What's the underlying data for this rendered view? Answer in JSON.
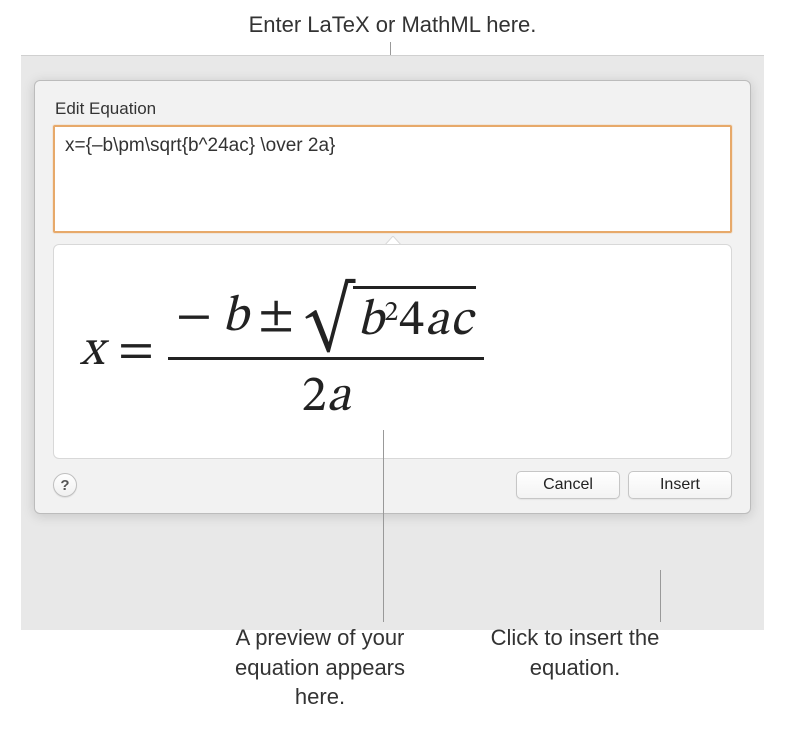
{
  "callouts": {
    "top": "Enter LaTeX or MathML here.",
    "previewNote": "A preview of your equation appears here.",
    "insertNote": "Click to insert the equation."
  },
  "dialog": {
    "title": "Edit Equation",
    "inputValue": "x={–b\\pm\\sqrt{b^24ac} \\over 2a}",
    "helpLabel": "?",
    "cancelLabel": "Cancel",
    "insertLabel": "Insert"
  },
  "equation": {
    "lhs": "x",
    "eq": "=",
    "minus": "−",
    "b": "b",
    "pm": "±",
    "sqrt": "√",
    "radB": "b",
    "radExp": "2",
    "rad4": "4",
    "radA": "a",
    "radC": "c",
    "den2": "2",
    "denA": "a"
  }
}
